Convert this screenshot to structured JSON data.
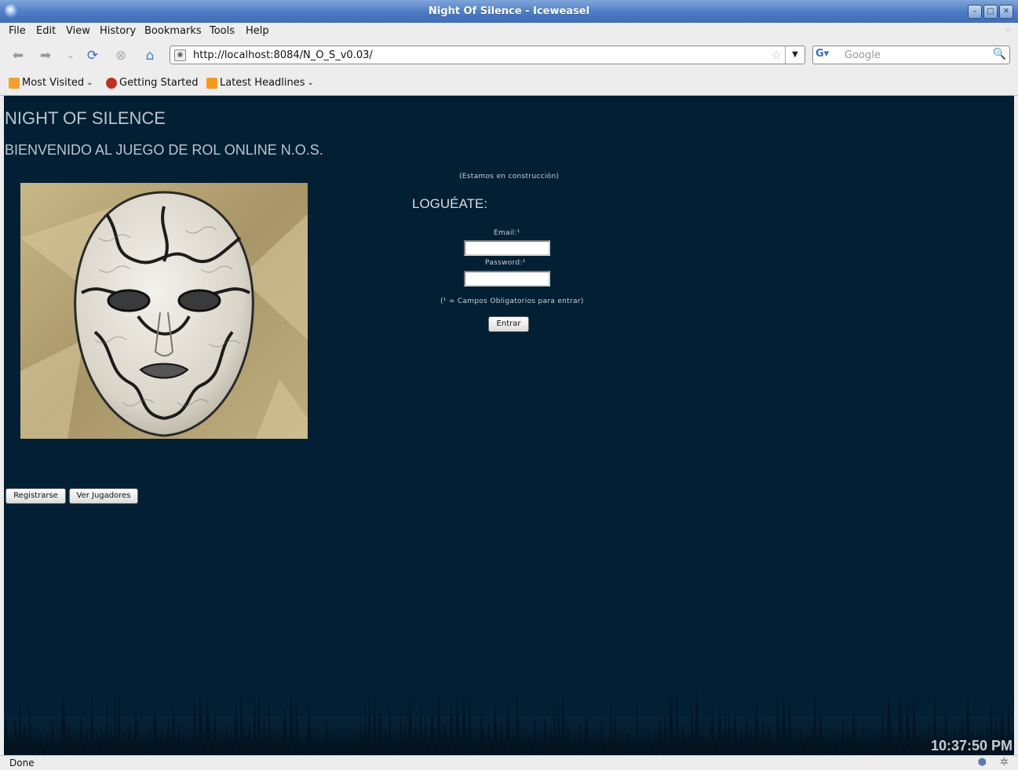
{
  "window": {
    "title": "Night Of Silence - Iceweasel"
  },
  "menu": {
    "items": [
      "File",
      "Edit",
      "View",
      "History",
      "Bookmarks",
      "Tools",
      "Help"
    ]
  },
  "navigation": {
    "url": "http://localhost:8084/N_O_S_v0.03/",
    "search_placeholder": "Google",
    "icons": [
      "back-icon",
      "forward-icon",
      "history-dropdown-icon",
      "reload-icon",
      "stop-icon",
      "home-icon"
    ]
  },
  "bookmarks": {
    "items": [
      "Most Visited",
      "Getting Started",
      "Latest Headlines"
    ]
  },
  "page": {
    "title": "NIGHT OF SILENCE",
    "subtitle": "BIENVENIDO AL JUEGO DE ROL ONLINE N.O.S.",
    "construction_note": "(Estamos en construcción)",
    "login_heading": "LOGUÉATE:",
    "email_label": "Email:¹",
    "password_label": "Password:¹",
    "required_note": "(¹ = Campos Obligatorios para entrar)",
    "enter_button": "Entrar",
    "register_button": "Registrarse",
    "players_button": "Ver Jugadores",
    "clock": "10:37:50 PM",
    "colors": {
      "background": "#031f33",
      "text": "#b9c6d0"
    }
  },
  "status": {
    "text": "Done"
  }
}
